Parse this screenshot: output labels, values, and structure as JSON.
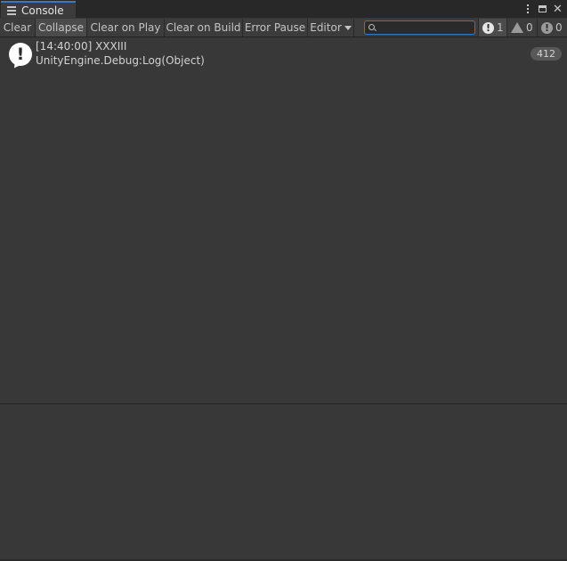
{
  "window": {
    "tab_title": "Console"
  },
  "toolbar": {
    "clear_label": "Clear",
    "collapse_label": "Collapse",
    "clear_on_play_label": "Clear on Play",
    "clear_on_build_label": "Clear on Build",
    "error_pause_label": "Error Pause",
    "editor_label": "Editor",
    "search_value": "",
    "info_count": "1",
    "warning_count": "0",
    "error_count": "0"
  },
  "log": {
    "entries": [
      {
        "line1": "[14:40:00] XXXIII",
        "line2": "UnityEngine.Debug:Log(Object)",
        "count": "412",
        "icon": "info-icon"
      }
    ]
  },
  "colors": {
    "background": "#383838",
    "toolbar": "#3c3c3c",
    "tab_accent": "#3a79bb",
    "text": "#d2d2d2"
  }
}
